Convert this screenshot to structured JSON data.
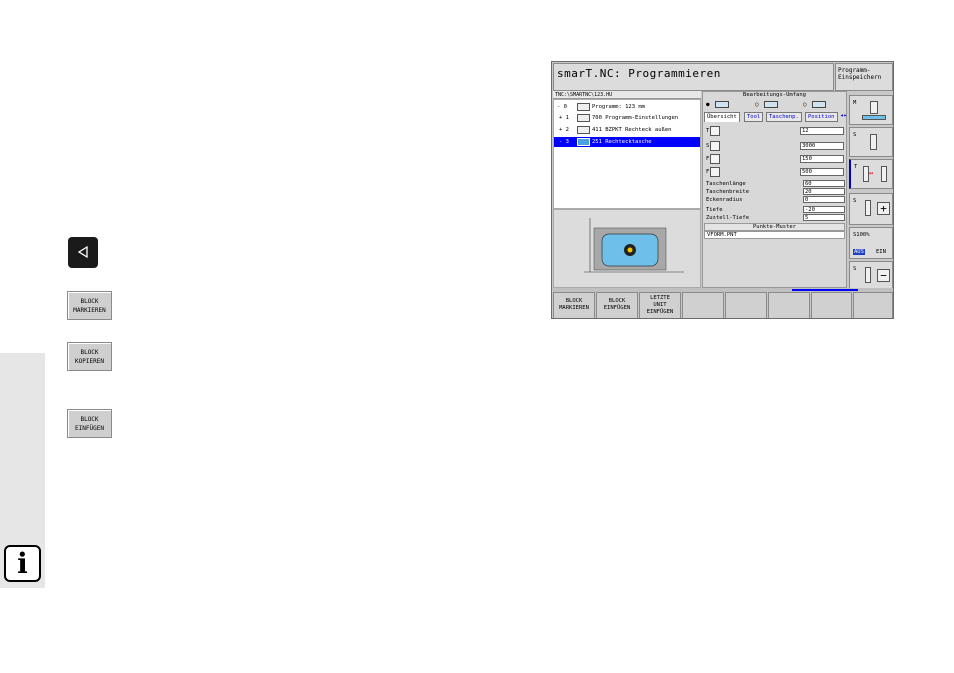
{
  "left_panel": {
    "back_key_icon": "triangle-left-icon",
    "softkeys": [
      {
        "line1": "BLOCK",
        "line2": "MARKIEREN"
      },
      {
        "line1": "BLOCK",
        "line2": "KOPIEREN"
      },
      {
        "line1": "BLOCK",
        "line2": "EINFÜGEN"
      }
    ],
    "info_icon": "i"
  },
  "screen": {
    "title": "smarT.NC: Programmieren",
    "title_button": {
      "line1": "Programm-",
      "line2": "Einspeichern"
    },
    "path": "TNC:\\SMARTNC\\123.HU",
    "tree": [
      {
        "prefix": "- 0",
        "text": "Programm: 123 mm",
        "selected": false
      },
      {
        "prefix": "+ 1",
        "text": "700 Programm-Einstellungen",
        "selected": false
      },
      {
        "prefix": "+ 2",
        "text": "411 BZPKT Rechteck außen",
        "selected": false
      },
      {
        "prefix": "- 3",
        "text": "251 Rechtecktasche",
        "selected": true
      }
    ],
    "form": {
      "header": "Bearbeitungs-Umfang",
      "tabs": [
        "Übersicht",
        "Tool",
        "Taschenp.",
        "Position"
      ],
      "tool_fields": [
        {
          "label": "T",
          "value": "12"
        },
        {
          "label": "S",
          "value": "3000"
        },
        {
          "label": "F",
          "value": "150"
        },
        {
          "label": "F",
          "value": "500"
        }
      ],
      "params": [
        {
          "label": "Taschenlänge",
          "value": "60"
        },
        {
          "label": "Taschenbreite",
          "value": "20"
        },
        {
          "label": "Eckenradius",
          "value": "0"
        },
        {
          "label": "Tiefe",
          "value": "-20"
        },
        {
          "label": "Zustell-Tiefe",
          "value": "5"
        }
      ],
      "pattern_header": "Punkte-Muster",
      "pattern_value": "VFORM.PNT"
    },
    "vertical_softkeys": [
      {
        "label": "M"
      },
      {
        "label": "S"
      },
      {
        "label": "T"
      },
      {
        "label": "S"
      },
      {
        "label": "S100%",
        "aut": "AUS",
        "ein": "EIN"
      },
      {
        "label": "S"
      }
    ],
    "horizontal_softkeys": [
      {
        "line1": "BLOCK",
        "line2": "MARKIEREN",
        "line3": ""
      },
      {
        "line1": "BLOCK",
        "line2": "EINFÜGEN",
        "line3": ""
      },
      {
        "line1": "LETZTE",
        "line2": "UNIT",
        "line3": "EINFÜGEN"
      },
      {
        "line1": "",
        "line2": "",
        "line3": ""
      },
      {
        "line1": "",
        "line2": "",
        "line3": ""
      },
      {
        "line1": "",
        "line2": "",
        "line3": ""
      },
      {
        "line1": "",
        "line2": "",
        "line3": ""
      },
      {
        "line1": "",
        "line2": "",
        "line3": ""
      }
    ]
  },
  "colors": {
    "selection": "#0000ff",
    "pocket": "#6ec0ea",
    "tab_text": "#0000cc"
  }
}
